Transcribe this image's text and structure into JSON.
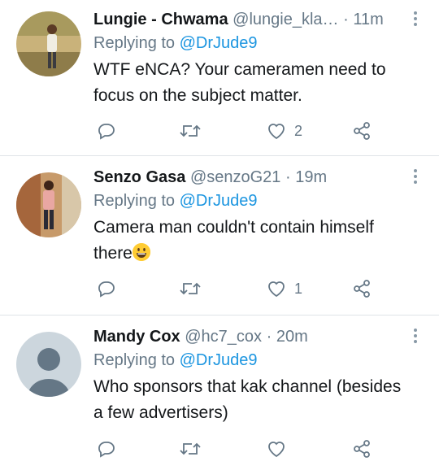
{
  "tweets": [
    {
      "name": "Lungie - Chwama",
      "handle": "@lungie_kla…",
      "separator": "·",
      "time": "11m",
      "replying_prefix": "Replying to ",
      "replying_to": "@DrJude9",
      "text": "WTF eNCA? Your cameramen need to focus on the subject matter.",
      "likes": "2"
    },
    {
      "name": "Senzo Gasa",
      "handle": "@senzoG21",
      "separator": "·",
      "time": "19m",
      "replying_prefix": "Replying to ",
      "replying_to": "@DrJude9",
      "text": "Camera man couldn't contain himself there",
      "likes": "1"
    },
    {
      "name": "Mandy Cox",
      "handle": "@hc7_cox",
      "separator": "·",
      "time": "20m",
      "replying_prefix": "Replying to ",
      "replying_to": "@DrJude9",
      "text": "Who sponsors that kak channel (besides a few advertisers)",
      "likes": ""
    }
  ],
  "colors": {
    "accent": "#1b95e0",
    "muted": "#657786",
    "divider": "#dfe4e8"
  },
  "icons": [
    "reply-icon",
    "retweet-icon",
    "like-icon",
    "share-icon",
    "more-options-icon",
    "grinning-face-emoji"
  ]
}
